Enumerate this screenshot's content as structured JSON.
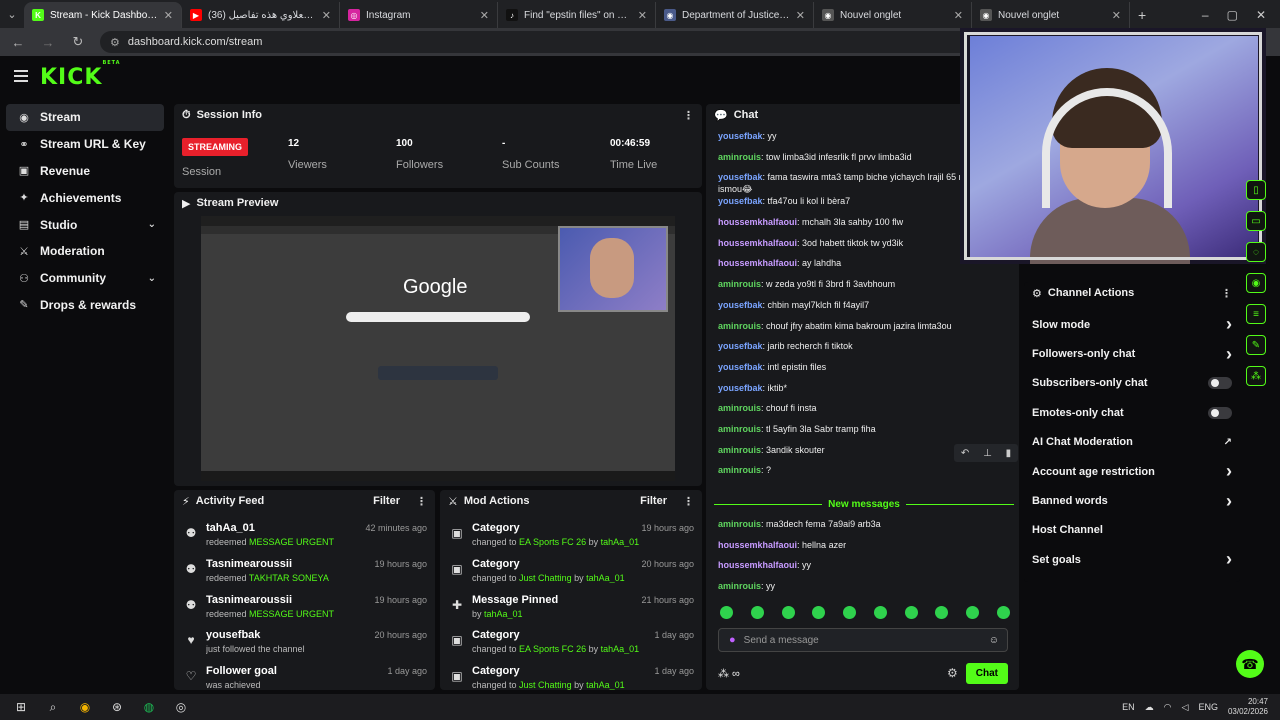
{
  "browser": {
    "tabs": [
      {
        "title": "Stream - Kick Dashboard",
        "fav": "K",
        "color": "#53fc18",
        "active": true
      },
      {
        "title": "طارق الكعلاوي هذه تفاصيل (36)",
        "fav": "▶",
        "color": "#ff0000",
        "active": false
      },
      {
        "title": "Instagram",
        "fav": "◎",
        "color": "#d6249f",
        "active": false
      },
      {
        "title": "Find \"epstin files\" on TikTok | Ti",
        "fav": "♪",
        "color": "#111111",
        "active": false
      },
      {
        "title": "Department of Justice | Homep",
        "fav": "◉",
        "color": "#4a5a8a",
        "active": false
      },
      {
        "title": "Nouvel onglet",
        "fav": "◉",
        "color": "#555555",
        "active": false
      },
      {
        "title": "Nouvel onglet",
        "fav": "◉",
        "color": "#555555",
        "active": false
      }
    ],
    "url": "dashboard.kick.com/stream"
  },
  "brand": {
    "logo": "KICK",
    "beta": "BETA"
  },
  "sidebar": {
    "items": [
      {
        "label": "Stream",
        "icon": "signal-icon",
        "glyph": "◉",
        "active": true,
        "chevron": false
      },
      {
        "label": "Stream URL & Key",
        "icon": "link-icon",
        "glyph": "⚭",
        "active": false,
        "chevron": false
      },
      {
        "label": "Revenue",
        "icon": "revenue-icon",
        "glyph": "▣",
        "active": false,
        "chevron": false
      },
      {
        "label": "Achievements",
        "icon": "trophy-icon",
        "glyph": "✦",
        "active": false,
        "chevron": false
      },
      {
        "label": "Studio",
        "icon": "studio-icon",
        "glyph": "▤",
        "active": false,
        "chevron": true
      },
      {
        "label": "Moderation",
        "icon": "sword-icon",
        "glyph": "⚔",
        "active": false,
        "chevron": false
      },
      {
        "label": "Community",
        "icon": "community-icon",
        "glyph": "⚇",
        "active": false,
        "chevron": true
      },
      {
        "label": "Drops & rewards",
        "icon": "gift-icon",
        "glyph": "✎",
        "active": false,
        "chevron": false
      }
    ]
  },
  "session": {
    "title": "Session Info",
    "badge": "STREAMING",
    "session_label": "Session",
    "stats": [
      {
        "value": "12",
        "label": "Viewers"
      },
      {
        "value": "100",
        "label": "Followers"
      },
      {
        "value": "-",
        "label": "Sub Counts"
      },
      {
        "value": "00:46:59",
        "label": "Time Live"
      }
    ]
  },
  "preview": {
    "title": "Stream Preview",
    "google": "Google"
  },
  "activity": {
    "title": "Activity Feed",
    "filter": "Filter",
    "items": [
      {
        "name": "tahAa_01",
        "pre": "redeemed ",
        "hl": "MESSAGE URGENT",
        "time": "42 minutes ago",
        "icon": "redeem-icon",
        "glyph": "⚉"
      },
      {
        "name": "Tasnimearoussii",
        "pre": "redeemed ",
        "hl": "TAKHTAR SONEYA",
        "time": "19 hours ago",
        "icon": "redeem-icon",
        "glyph": "⚉"
      },
      {
        "name": "Tasnimearoussii",
        "pre": "redeemed ",
        "hl": "MESSAGE URGENT",
        "time": "19 hours ago",
        "icon": "redeem-icon",
        "glyph": "⚉"
      },
      {
        "name": "yousefbak",
        "pre": "just followed the channel",
        "hl": "",
        "time": "20 hours ago",
        "icon": "heart-icon",
        "glyph": "♥"
      },
      {
        "name": "Follower goal",
        "pre": "was achieved",
        "hl": "",
        "time": "1 day ago",
        "icon": "heart-outline-icon",
        "glyph": "♡"
      }
    ]
  },
  "modactions": {
    "title": "Mod Actions",
    "filter": "Filter",
    "items": [
      {
        "name": "Category",
        "pre": "changed to ",
        "hl": "EA Sports FC 26",
        "by": " by ",
        "user": "tahAa_01",
        "time": "19 hours ago",
        "icon": "category-icon",
        "glyph": "▣"
      },
      {
        "name": "Category",
        "pre": "changed to ",
        "hl": "Just Chatting",
        "by": " by ",
        "user": "tahAa_01",
        "time": "20 hours ago",
        "icon": "category-icon",
        "glyph": "▣"
      },
      {
        "name": "Message Pinned",
        "pre": "by ",
        "hl": "",
        "by": "",
        "user": "tahAa_01",
        "time": "21 hours ago",
        "icon": "pin-icon",
        "glyph": "✚"
      },
      {
        "name": "Category",
        "pre": "changed to ",
        "hl": "EA Sports FC 26",
        "by": " by ",
        "user": "tahAa_01",
        "time": "1 day ago",
        "icon": "category-icon",
        "glyph": "▣"
      },
      {
        "name": "Category",
        "pre": "changed to ",
        "hl": "Just Chatting",
        "by": " by ",
        "user": "tahAa_01",
        "time": "1 day ago",
        "icon": "category-icon",
        "glyph": "▣"
      }
    ]
  },
  "chat": {
    "title": "Chat",
    "messages": [
      {
        "user": "yousefbak",
        "color": "blue",
        "text": "yy"
      },
      {
        "user": "aminrouis",
        "color": "green",
        "text": "tow limba3id infesrlik fl prvv limba3id"
      },
      {
        "user": "yousefbak",
        "color": "blue",
        "text": "fama taswira mta3 tamp biche yichaych lrajil 65 mana3rich ismou😂"
      },
      {
        "user": "yousefbak",
        "color": "blue",
        "text": "tfa47ou li kol li bèra7"
      },
      {
        "user": "houssemkhalfaoui",
        "color": "purple",
        "text": "mchalh 3la sahby 100 flw"
      },
      {
        "user": "houssemkhalfaoui",
        "color": "purple",
        "text": "3od habett tiktok tw yd3ik"
      },
      {
        "user": "houssemkhalfaoui",
        "color": "purple",
        "text": "ay lahdha"
      },
      {
        "user": "aminrouis",
        "color": "green",
        "text": "w zeda yo9tl fi 3brd fi 3avbhoum"
      },
      {
        "user": "yousefbak",
        "color": "blue",
        "text": "chbin mayl7klch fil f4ayil7"
      },
      {
        "user": "aminrouis",
        "color": "green",
        "text": "chouf jfry abatim kima bakroum jazira limta3ou"
      },
      {
        "user": "yousefbak",
        "color": "blue",
        "text": "jarib recherch fi tiktok"
      },
      {
        "user": "yousefbak",
        "color": "blue",
        "text": "intl epistin files"
      },
      {
        "user": "yousefbak",
        "color": "blue",
        "text": "iktib*"
      },
      {
        "user": "aminrouis",
        "color": "green",
        "text": "chouf fi insta"
      },
      {
        "user": "aminrouis",
        "color": "green",
        "text": "tl 5ayfin 3la Sabr tramp fiha"
      },
      {
        "user": "aminrouis",
        "color": "green",
        "text": "3andik skouter"
      },
      {
        "user": "aminrouis",
        "color": "green",
        "text": "?"
      }
    ],
    "new_messages_label": "New messages",
    "new_messages": [
      {
        "user": "aminrouis",
        "color": "green",
        "text": "ma3dech fema 7a9ai9 arb3a"
      },
      {
        "user": "houssemkhalfaoui",
        "color": "purple",
        "text": "hellna azer"
      },
      {
        "user": "houssemkhalfaoui",
        "color": "purple",
        "text": "yy"
      },
      {
        "user": "aminrouis",
        "color": "green",
        "text": "yy"
      }
    ],
    "input_placeholder": "Send a message",
    "send_label": "Chat"
  },
  "channel_actions": {
    "title": "Channel Actions",
    "rows": [
      {
        "label": "Slow mode",
        "type": "arrow"
      },
      {
        "label": "Followers-only chat",
        "type": "arrow"
      },
      {
        "label": "Subscribers-only chat",
        "type": "toggle"
      },
      {
        "label": "Emotes-only chat",
        "type": "toggle"
      },
      {
        "label": "AI Chat Moderation",
        "type": "link"
      },
      {
        "label": "Account age restriction",
        "type": "arrow"
      },
      {
        "label": "Banned words",
        "type": "arrow"
      },
      {
        "label": "Host Channel",
        "type": "none"
      },
      {
        "label": "Set goals",
        "type": "arrow"
      }
    ]
  },
  "taskbar": {
    "lang": "EN",
    "kbd": "ENG",
    "time": "20:47",
    "date": "03/02/2026"
  }
}
